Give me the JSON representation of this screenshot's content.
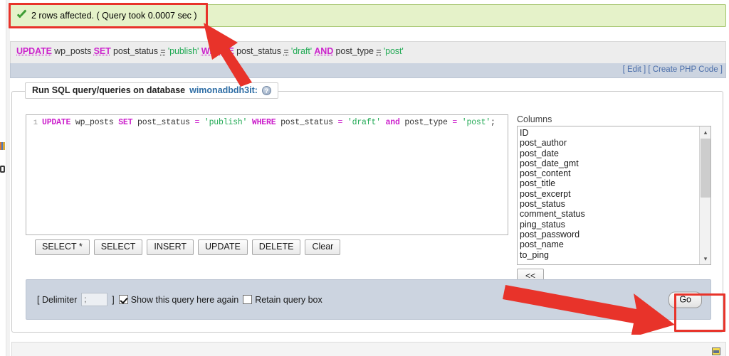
{
  "status_message": {
    "icon": "check-icon",
    "text": "2 rows affected. ( Query took 0.0007 sec )"
  },
  "executed_query": {
    "tokens": [
      {
        "t": "UPDATE",
        "k": "kw"
      },
      {
        "t": "wp_posts",
        "k": "id"
      },
      {
        "t": "SET",
        "k": "kw"
      },
      {
        "t": "post_status",
        "k": "id"
      },
      {
        "t": "=",
        "k": "op"
      },
      {
        "t": "'publish'",
        "k": "str"
      },
      {
        "t": "WHERE",
        "k": "kw"
      },
      {
        "t": "post_status",
        "k": "id"
      },
      {
        "t": "=",
        "k": "op"
      },
      {
        "t": "'draft'",
        "k": "str"
      },
      {
        "t": "AND",
        "k": "kw"
      },
      {
        "t": "post_type",
        "k": "id"
      },
      {
        "t": "=",
        "k": "op"
      },
      {
        "t": "'post'",
        "k": "str"
      }
    ],
    "plain": "UPDATE wp_posts SET post_status = 'publish' WHERE post_status = 'draft' AND post_type = 'post'",
    "actions": {
      "edit": "[ Edit ]",
      "create_php": "[ Create PHP Code ]"
    }
  },
  "fieldset": {
    "legend_prefix": "Run SQL query/queries on database",
    "database_name": "wimonadbdh3it:",
    "legend_suffix": "",
    "help_icon": "help-icon"
  },
  "sql_editor": {
    "line_number": "1",
    "value": "UPDATE wp_posts SET post_status = 'publish' WHERE post_status = 'draft' and post_type = 'post';",
    "tokens": [
      {
        "t": "UPDATE",
        "k": "kw"
      },
      {
        "t": "wp_posts",
        "k": "var"
      },
      {
        "t": "SET",
        "k": "kw"
      },
      {
        "t": "post_status",
        "k": "var"
      },
      {
        "t": "=",
        "k": "op"
      },
      {
        "t": "'publish'",
        "k": "str"
      },
      {
        "t": "WHERE",
        "k": "kw"
      },
      {
        "t": "post_status",
        "k": "var"
      },
      {
        "t": "=",
        "k": "op"
      },
      {
        "t": "'draft'",
        "k": "str"
      },
      {
        "t": "and",
        "k": "kw"
      },
      {
        "t": "post_type",
        "k": "var"
      },
      {
        "t": "=",
        "k": "op"
      },
      {
        "t": "'post'",
        "k": "str"
      },
      {
        "t": ";",
        "k": "punct"
      }
    ]
  },
  "query_buttons": [
    {
      "label": "SELECT *",
      "name": "select-star-button"
    },
    {
      "label": "SELECT",
      "name": "select-button"
    },
    {
      "label": "INSERT",
      "name": "insert-button"
    },
    {
      "label": "UPDATE",
      "name": "update-button"
    },
    {
      "label": "DELETE",
      "name": "delete-button"
    },
    {
      "label": "Clear",
      "name": "clear-button"
    }
  ],
  "columns_panel": {
    "label": "Columns",
    "items": [
      "ID",
      "post_author",
      "post_date",
      "post_date_gmt",
      "post_content",
      "post_title",
      "post_excerpt",
      "post_status",
      "comment_status",
      "ping_status",
      "post_password",
      "post_name",
      "to_ping"
    ],
    "insert_button": "<<",
    "scrollbar": {
      "up": "▴",
      "down": "▾"
    }
  },
  "delimiter_bar": {
    "open_bracket": "[ Delimiter",
    "value": ";",
    "close_bracket": "]",
    "show_query_label": "Show this query here again",
    "show_query_checked": true,
    "retain_box_label": "Retain query box",
    "retain_box_checked": false,
    "go_label": "Go"
  },
  "annotations": {
    "highlight_color": "#e8332a",
    "arrow_color": "#e8332a",
    "boxes": [
      "status-message-highlight",
      "go-button-highlight"
    ],
    "arrows": [
      "arrow-to-query-result",
      "arrow-to-go-button"
    ]
  }
}
